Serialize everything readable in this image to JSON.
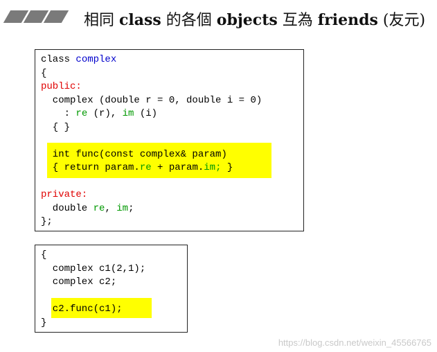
{
  "title": {
    "p1": "相同 ",
    "b1": "class",
    "p2": " 的各個 ",
    "b2": "objects",
    "p3": " 互為 ",
    "b3": "friends",
    "p4": " (友元)"
  },
  "box1": {
    "class_kw": "class ",
    "class_name": "complex",
    "open": "{",
    "public": "public:",
    "ctor": "  complex (double r = 0, double i = 0)",
    "init_a": "    : ",
    "init_re": "re",
    "init_b": " (r), ",
    "init_im": "im",
    "init_c": " (i)",
    "ctor_body": "  { }",
    "func_sig": "  int func(const complex& param)",
    "func_a": "  { return param.",
    "func_re": "re",
    "func_b": " + param.",
    "func_im": "im;",
    "func_c": " }",
    "private": "private:",
    "decl_a": "  double ",
    "decl_re": "re",
    "decl_b": ", ",
    "decl_im": "im",
    "decl_c": ";",
    "close": "};"
  },
  "box2": {
    "open": "{",
    "line1": "  complex c1(2,1);",
    "line2": "  complex c2;",
    "line3": "  c2.func(c1);",
    "close": "}"
  },
  "watermark": "https://blog.csdn.net/weixin_45566765",
  "colors": {
    "highlight": "#ffff00",
    "red": "#e00000",
    "blue": "#0000cc",
    "green": "#009900"
  }
}
